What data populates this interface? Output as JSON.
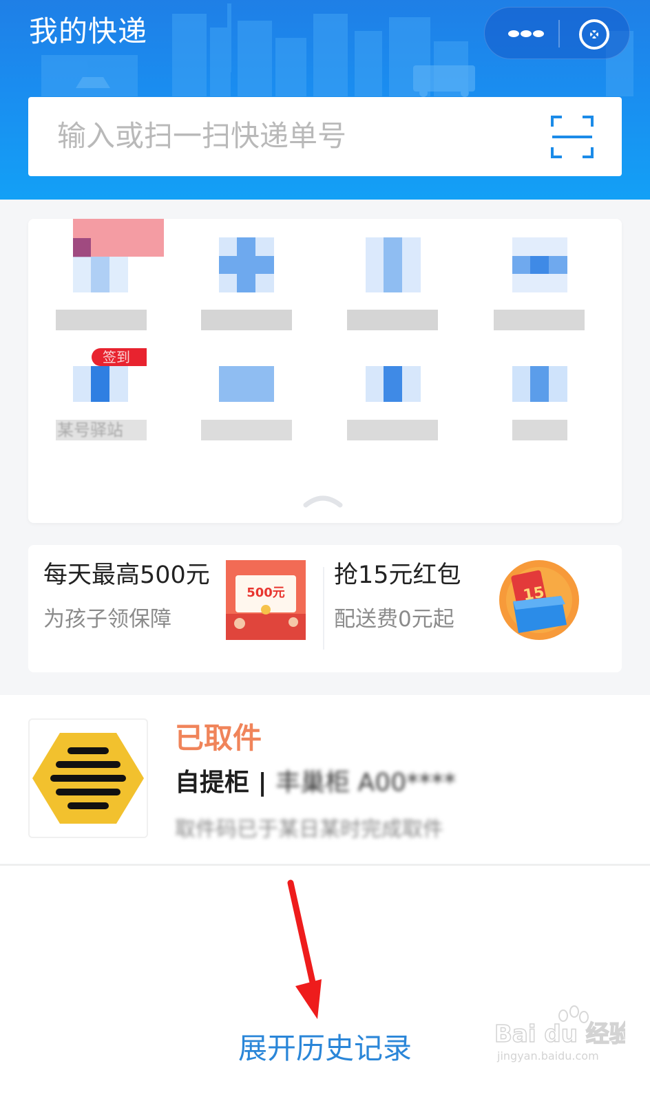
{
  "header": {
    "title": "我的快递",
    "bg_color": "#1a8df0",
    "more_icon": "more-dots-icon",
    "close_icon": "close-circle-icon"
  },
  "search": {
    "placeholder": "输入或扫一扫快递单号",
    "scan_icon": "scan-icon"
  },
  "services": {
    "items": [
      {
        "icon": "blurred-service-icon",
        "label": "",
        "badge": ""
      },
      {
        "icon": "blurred-service-icon",
        "label": "",
        "badge": ""
      },
      {
        "icon": "blurred-service-icon",
        "label": "",
        "badge": ""
      },
      {
        "icon": "blurred-service-icon",
        "label": "",
        "badge": ""
      },
      {
        "icon": "blurred-service-icon",
        "label": "某号驿站",
        "badge": "签到"
      },
      {
        "icon": "blurred-service-icon",
        "label": "",
        "badge": ""
      },
      {
        "icon": "blurred-service-icon",
        "label": "",
        "badge": ""
      },
      {
        "icon": "blurred-service-icon",
        "label": "",
        "badge": ""
      }
    ],
    "collapse_icon": "chevron-up-icon"
  },
  "promos": [
    {
      "title": "每天最高500元",
      "subtitle": "为孩子领保障",
      "image_text": "500元"
    },
    {
      "title": "抢15元红包",
      "subtitle": "配送费0元起",
      "image_text": "15"
    }
  ],
  "parcel": {
    "status": "已取件",
    "type_label": "自提柜 |",
    "location_blurred": "丰巢柜 A00****",
    "detail_blurred": "取件码已于某日某时完成取件",
    "status_color": "#f0845a"
  },
  "footer": {
    "history_label": "展开历史记录",
    "link_color": "#2a86d8",
    "watermark": "Bai du 经验",
    "watermark_url": "jingyan.baidu.com"
  }
}
